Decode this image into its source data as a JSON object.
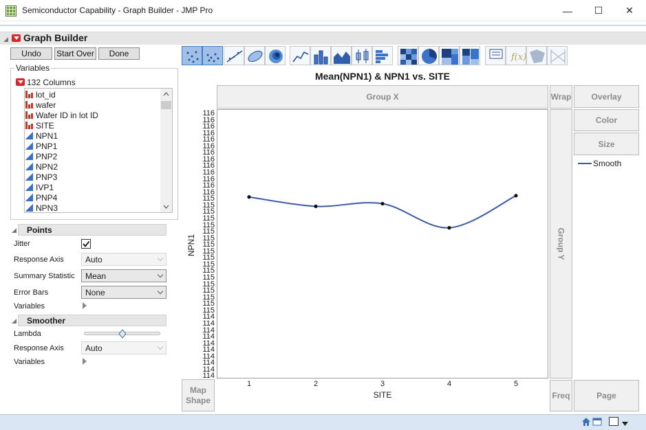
{
  "window": {
    "title": "Semiconductor Capability - Graph Builder - JMP Pro",
    "minimize": "—",
    "maximize": "☐",
    "close": "✕"
  },
  "outline": {
    "title": "Graph Builder"
  },
  "buttons": {
    "undo": "Undo",
    "start_over": "Start Over",
    "done": "Done"
  },
  "variables": {
    "legend": "Variables",
    "count": "132 Columns",
    "items": [
      {
        "label": "lot_id",
        "type": "nominal"
      },
      {
        "label": "wafer",
        "type": "nominal"
      },
      {
        "label": "Wafer ID in lot ID",
        "type": "nominal"
      },
      {
        "label": "SITE",
        "type": "nominal"
      },
      {
        "label": "NPN1",
        "type": "continuous"
      },
      {
        "label": "PNP1",
        "type": "continuous"
      },
      {
        "label": "PNP2",
        "type": "continuous"
      },
      {
        "label": "NPN2",
        "type": "continuous"
      },
      {
        "label": "PNP3",
        "type": "continuous"
      },
      {
        "label": "IVP1",
        "type": "continuous"
      },
      {
        "label": "PNP4",
        "type": "continuous"
      },
      {
        "label": "NPN3",
        "type": "continuous"
      }
    ]
  },
  "points": {
    "title": "Points",
    "jitter_label": "Jitter",
    "jitter_checked": true,
    "response_axis_label": "Response Axis",
    "response_axis_value": "Auto",
    "summary_label": "Summary Statistic",
    "summary_value": "Mean",
    "error_bars_label": "Error Bars",
    "error_bars_value": "None",
    "variables_label": "Variables"
  },
  "smoother": {
    "title": "Smoother",
    "lambda_label": "Lambda",
    "lambda_value": 0.5,
    "response_axis_label": "Response Axis",
    "response_axis_value": "Auto",
    "variables_label": "Variables"
  },
  "toolbar": {
    "icons": [
      "points-icon",
      "jitter-points-icon",
      "line-of-fit-icon",
      "ellipse-icon",
      "contour-icon",
      "line-icon",
      "bar-icon",
      "area-icon",
      "box-plot-icon",
      "histogram-icon",
      "heatmap-icon",
      "pie-icon",
      "treemap-icon",
      "mosaic-icon",
      "caption-box-icon",
      "formula-icon",
      "map-shapes-icon",
      "parallel-icon"
    ]
  },
  "zones": {
    "group_x": "Group X",
    "wrap": "Wrap",
    "overlay": "Overlay",
    "color": "Color",
    "size": "Size",
    "group_y": "Group Y",
    "map_shape_1": "Map",
    "map_shape_2": "Shape",
    "freq": "Freq",
    "page": "Page"
  },
  "legend": {
    "item": "Smooth",
    "color": "#3a5aa8"
  },
  "chart_data": {
    "type": "line",
    "title": "Mean(NPN1) & NPN1 vs. SITE",
    "xlabel": "SITE",
    "ylabel": "NPN1",
    "categories": [
      "1",
      "2",
      "3",
      "4",
      "5"
    ],
    "series": [
      {
        "name": "Smooth",
        "values": [
          115.35,
          115.28,
          115.3,
          115.12,
          115.36
        ]
      }
    ],
    "ylim": [
      114,
      116
    ],
    "y_tick_labels": [
      "116",
      "116",
      "116",
      "116",
      "116",
      "116",
      "116",
      "116",
      "116",
      "116",
      "116",
      "116",
      "116",
      "115",
      "115",
      "115",
      "115",
      "115",
      "115",
      "115",
      "115",
      "115",
      "115",
      "115",
      "115",
      "115",
      "115",
      "115",
      "115",
      "115",
      "115",
      "114",
      "114",
      "114",
      "114",
      "114",
      "114",
      "114",
      "114",
      "114",
      "114"
    ]
  }
}
